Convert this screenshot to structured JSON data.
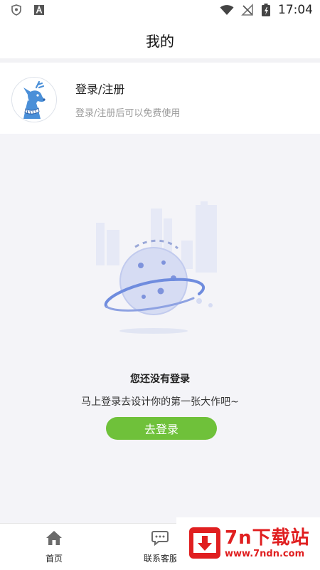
{
  "status_bar": {
    "time": "17:04"
  },
  "header": {
    "title": "我的"
  },
  "profile": {
    "title": "登录/注册",
    "subtitle": "登录/注册后可以免费使用"
  },
  "empty_state": {
    "title": "您还没有登录",
    "subtitle": "马上登录去设计你的第一张大作吧~",
    "button_label": "去登录"
  },
  "tab_bar": {
    "items": [
      {
        "label": "首页",
        "icon": "home-icon"
      },
      {
        "label": "联系客服",
        "icon": "chat-icon"
      }
    ]
  },
  "watermark": {
    "title": "7n下载站",
    "url": "www.7ndn.com"
  },
  "colors": {
    "accent_green": "#6fc13a",
    "watermark_red": "#e01f20",
    "planet_blue": "#6f8cde"
  }
}
